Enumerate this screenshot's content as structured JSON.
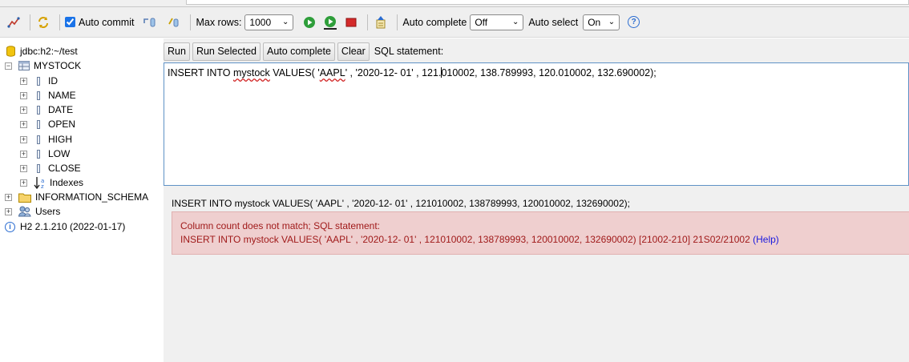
{
  "toolbar": {
    "auto_commit_label": "Auto commit",
    "auto_commit_checked": true,
    "max_rows_label": "Max rows:",
    "max_rows_value": "1000",
    "auto_complete_label": "Auto complete",
    "auto_complete_value": "Off",
    "auto_select_label": "Auto select",
    "auto_select_value": "On",
    "help_glyph": "?"
  },
  "tree": {
    "connection": "jdbc:h2:~/test",
    "table": "MYSTOCK",
    "columns": [
      "ID",
      "NAME",
      "DATE",
      "OPEN",
      "HIGH",
      "LOW",
      "CLOSE"
    ],
    "indexes": "Indexes",
    "info_schema": "INFORMATION_SCHEMA",
    "users": "Users",
    "version": "H2 2.1.210 (2022-01-17)"
  },
  "main": {
    "buttons": {
      "run": "Run",
      "run_selected": "Run Selected",
      "auto_complete": "Auto complete",
      "clear": "Clear"
    },
    "sql_label": "SQL statement:",
    "editor": {
      "p1": "INSERT INTO ",
      "p2": "mystock",
      "p3": " VALUES( '",
      "p4": "AAPL",
      "p5": "' , '2020-12- 01' , 121.",
      "p6": "010002, 138.789993, 120.010002, 132.690002);"
    },
    "result_text": "INSERT INTO mystock VALUES( 'AAPL' , '2020-12- 01' , 121010002, 138789993, 120010002, 132690002);",
    "error": {
      "line1": "Column count does not match; SQL statement:",
      "line2": "INSERT INTO mystock VALUES( 'AAPL' , '2020-12- 01' , 121010002, 138789993, 120010002, 132690002) [21002-210] 21S02/21002 ",
      "help": "(Help)"
    }
  },
  "colors": {
    "error_bg": "#efcfcf",
    "error_text": "#a01a1a",
    "link": "#1a1adf",
    "editor_border": "#5f92c6"
  }
}
